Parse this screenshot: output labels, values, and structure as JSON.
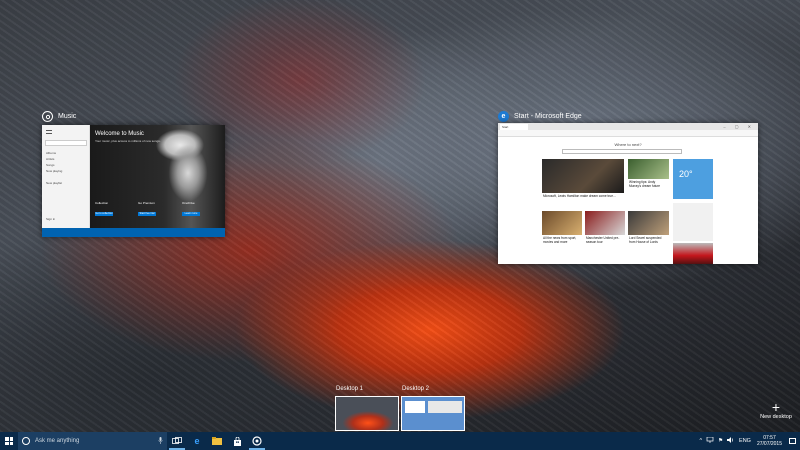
{
  "task_view": {
    "windows": [
      {
        "app": "Music",
        "title": "Music"
      },
      {
        "app": "Edge",
        "title": "Start - Microsoft Edge"
      }
    ]
  },
  "music_app": {
    "welcome": "Welcome to Music",
    "subtitle": "Your music, plus access to millions of new songs.",
    "nav": [
      "Albums",
      "Artists",
      "Songs",
      "Now playing"
    ],
    "new_playlist": "New playlist",
    "columns": [
      {
        "title": "Collection",
        "button": "Go to collection"
      },
      {
        "title": "Go Premium",
        "button": "Start free trial"
      },
      {
        "title": "OneDrive",
        "button": "Learn more"
      }
    ],
    "user_label": "Sign in"
  },
  "edge_app": {
    "tab_label": "Start",
    "ask_text": "Where to next?",
    "weather_temp": "20°",
    "news": [
      {
        "headline": "Microsoft, Lewis Hamilton make dream come true..."
      },
      {
        "headline": "Winning tips: Andy Murray's dream future"
      },
      {
        "headline": "All the news from sport, movies and more"
      },
      {
        "headline": "Manchester United pre-season tour"
      },
      {
        "headline": "Lord Sewel suspended from House of Lords"
      }
    ]
  },
  "desktops": [
    {
      "label": "Desktop 1"
    },
    {
      "label": "Desktop 2"
    }
  ],
  "new_desktop_label": "New desktop",
  "taskbar": {
    "search_placeholder": "Ask me anything",
    "language": "ENG",
    "time": "07:57",
    "date": "27/07/2015"
  },
  "colors": {
    "taskbar": "#0a2a4a",
    "accent": "#0078d7",
    "lava": "#ff5018"
  }
}
